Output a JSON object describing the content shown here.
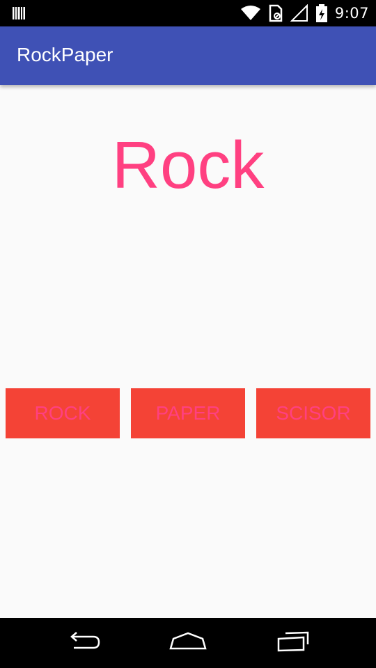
{
  "status_bar": {
    "time": "9:07",
    "icons": [
      "barcode-icon",
      "wifi-icon",
      "sim-card-icon",
      "signal-icon",
      "battery-icon"
    ]
  },
  "app_bar": {
    "title": "RockPaper",
    "background": "#3f51b5"
  },
  "main": {
    "result_text": "Rock",
    "result_color": "#ff4081",
    "buttons": [
      {
        "label": "ROCK"
      },
      {
        "label": "PAPER"
      },
      {
        "label": "SCISOR"
      }
    ],
    "button_background": "#f44336"
  },
  "nav_bar": {
    "icons": [
      "back-icon",
      "home-icon",
      "recents-icon"
    ]
  }
}
